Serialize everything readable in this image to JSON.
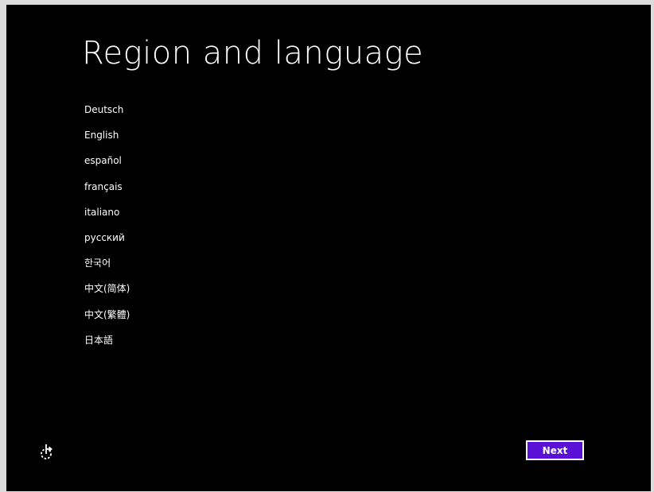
{
  "title": "Region and language",
  "languages": [
    {
      "label": "Deutsch"
    },
    {
      "label": "English"
    },
    {
      "label": "español"
    },
    {
      "label": "français"
    },
    {
      "label": "italiano"
    },
    {
      "label": "русский"
    },
    {
      "label": "한국어"
    },
    {
      "label": "中文(简体)"
    },
    {
      "label": "中文(繁體)"
    },
    {
      "label": "日本語"
    }
  ],
  "accessibility": {
    "icon": "ease-of-access-icon"
  },
  "next_button": {
    "label": "Next"
  },
  "colors": {
    "background": "#000000",
    "text": "#ffffff",
    "accent": "#5a10d6",
    "frame": "#dcdcdc"
  }
}
